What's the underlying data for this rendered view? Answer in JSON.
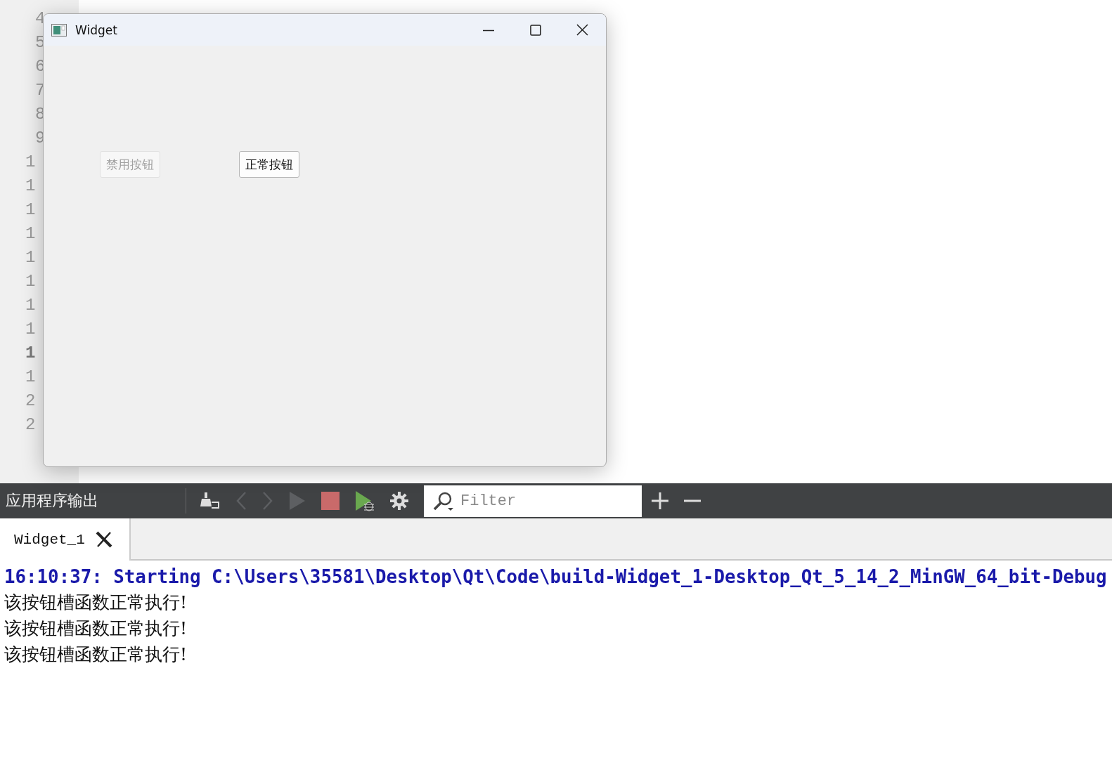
{
  "editor": {
    "line_numbers": [
      {
        "text": "4",
        "kind": "units",
        "current": false
      },
      {
        "text": "5",
        "kind": "units",
        "current": false
      },
      {
        "text": "6",
        "kind": "units",
        "current": false
      },
      {
        "text": "7",
        "kind": "units",
        "current": false
      },
      {
        "text": "8",
        "kind": "units",
        "current": false
      },
      {
        "text": "9",
        "kind": "units",
        "current": false
      },
      {
        "text": "1",
        "kind": "tens",
        "current": false
      },
      {
        "text": "1",
        "kind": "tens",
        "current": false
      },
      {
        "text": "1",
        "kind": "tens",
        "current": false
      },
      {
        "text": "1",
        "kind": "tens",
        "current": false
      },
      {
        "text": "1",
        "kind": "tens",
        "current": false
      },
      {
        "text": "1",
        "kind": "tens",
        "current": false
      },
      {
        "text": "1",
        "kind": "tens",
        "current": false
      },
      {
        "text": "1",
        "kind": "tens",
        "current": false
      },
      {
        "text": "1",
        "kind": "tens",
        "current": true
      },
      {
        "text": "1",
        "kind": "tens",
        "current": false
      },
      {
        "text": "2",
        "kind": "tens",
        "current": false
      },
      {
        "text": "2",
        "kind": "tens",
        "current": false
      }
    ]
  },
  "window": {
    "title": "Widget",
    "buttons": [
      {
        "label": "禁用按钮",
        "disabled": true
      },
      {
        "label": "正常按钮",
        "disabled": false
      }
    ]
  },
  "output_pane": {
    "title": "应用程序输出",
    "toolbar": [
      {
        "kind": "clear",
        "disabled": false
      },
      {
        "kind": "back",
        "disabled": true
      },
      {
        "kind": "forward",
        "disabled": true
      },
      {
        "kind": "run",
        "disabled": true
      },
      {
        "kind": "stop",
        "disabled": false
      },
      {
        "kind": "debug",
        "disabled": false
      },
      {
        "kind": "settings",
        "disabled": false
      }
    ],
    "filter": {
      "placeholder": "Filter"
    },
    "tabs": [
      {
        "label": "Widget_1",
        "selected": true
      }
    ],
    "lines": [
      {
        "text": "16:10:37: Starting C:\\Users\\35581\\Desktop\\Qt\\Code\\build-Widget_1-Desktop_Qt_5_14_2_MinGW_64_bit-Debug",
        "kind": "system"
      },
      {
        "text": "该按钮槽函数正常执行!",
        "kind": "stdout"
      },
      {
        "text": "该按钮槽函数正常执行!",
        "kind": "stdout"
      },
      {
        "text": "该按钮槽函数正常执行!",
        "kind": "stdout"
      }
    ]
  }
}
